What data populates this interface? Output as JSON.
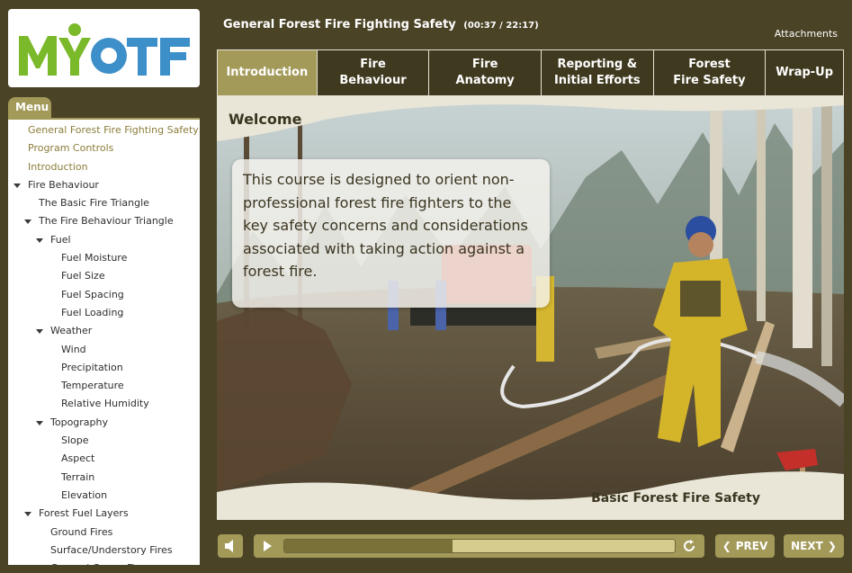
{
  "logo": {
    "text": "MYOTF"
  },
  "menu": {
    "tab_label": "Menu",
    "items": [
      {
        "label": "General Forest Fire Fighting Safety",
        "indent": 0,
        "expander": false,
        "olive": true
      },
      {
        "label": "Program Controls",
        "indent": 0,
        "expander": false,
        "olive": true
      },
      {
        "label": "Introduction",
        "indent": 0,
        "expander": false,
        "olive": true
      },
      {
        "label": "Fire Behaviour",
        "indent": 0,
        "expander": true,
        "olive": false
      },
      {
        "label": "The Basic Fire Triangle",
        "indent": 1,
        "expander": false,
        "olive": false
      },
      {
        "label": "The Fire Behaviour Triangle",
        "indent": 1,
        "expander": true,
        "olive": false
      },
      {
        "label": "Fuel",
        "indent": 2,
        "expander": true,
        "olive": false
      },
      {
        "label": "Fuel Moisture",
        "indent": 3,
        "expander": false,
        "olive": false
      },
      {
        "label": "Fuel Size",
        "indent": 3,
        "expander": false,
        "olive": false
      },
      {
        "label": "Fuel Spacing",
        "indent": 3,
        "expander": false,
        "olive": false
      },
      {
        "label": "Fuel Loading",
        "indent": 3,
        "expander": false,
        "olive": false
      },
      {
        "label": "Weather",
        "indent": 2,
        "expander": true,
        "olive": false
      },
      {
        "label": "Wind",
        "indent": 3,
        "expander": false,
        "olive": false
      },
      {
        "label": "Precipitation",
        "indent": 3,
        "expander": false,
        "olive": false
      },
      {
        "label": "Temperature",
        "indent": 3,
        "expander": false,
        "olive": false
      },
      {
        "label": "Relative Humidity",
        "indent": 3,
        "expander": false,
        "olive": false
      },
      {
        "label": "Topography",
        "indent": 2,
        "expander": true,
        "olive": false
      },
      {
        "label": "Slope",
        "indent": 3,
        "expander": false,
        "olive": false
      },
      {
        "label": "Aspect",
        "indent": 3,
        "expander": false,
        "olive": false
      },
      {
        "label": "Terrain",
        "indent": 3,
        "expander": false,
        "olive": false
      },
      {
        "label": "Elevation",
        "indent": 3,
        "expander": false,
        "olive": false
      },
      {
        "label": "Forest Fuel Layers",
        "indent": 1,
        "expander": true,
        "olive": false
      },
      {
        "label": "Ground Fires",
        "indent": 2,
        "expander": false,
        "olive": false
      },
      {
        "label": "Surface/Understory Fires",
        "indent": 2,
        "expander": false,
        "olive": false
      },
      {
        "label": "General Crown Fires",
        "indent": 2,
        "expander": false,
        "olive": false
      }
    ]
  },
  "header": {
    "title": "General Forest Fire Fighting Safety",
    "time": "(00:37 / 22:17)",
    "attachments_label": "Attachments"
  },
  "tabs": [
    {
      "label": "Introduction",
      "active": true
    },
    {
      "label": "Fire\nBehaviour",
      "active": false
    },
    {
      "label": "Fire\nAnatomy",
      "active": false
    },
    {
      "label": "Reporting &\nInitial Efforts",
      "active": false
    },
    {
      "label": "Forest\nFire Safety",
      "active": false
    },
    {
      "label": "Wrap-Up",
      "active": false
    }
  ],
  "slide": {
    "heading": "Welcome",
    "body": "This course is designed to orient non-professional forest fire fighters to the key safety concerns and considerations associated with taking action against a forest fire.",
    "footer": "Basic Forest Fire Safety"
  },
  "controls": {
    "progress_fraction": 0.43,
    "prev_label": "PREV",
    "next_label": "NEXT"
  },
  "colors": {
    "frame": "#4a4326",
    "accent": "#a39a5a",
    "logo_green": "#7ab929",
    "logo_blue": "#3d8fc9"
  }
}
